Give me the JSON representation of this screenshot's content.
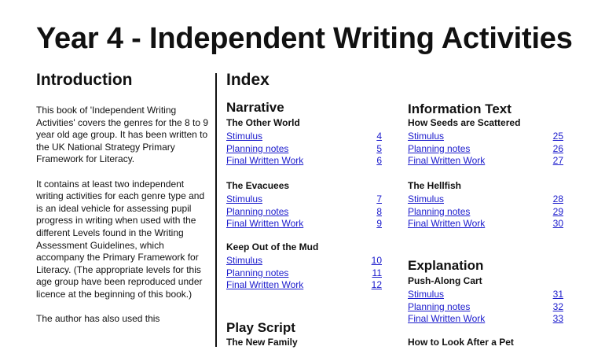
{
  "title": "Year 4 - Independent Writing Activities",
  "intro": {
    "heading": "Introduction",
    "paragraphs": [
      "This book of 'Independent Writing Activities' covers the genres for the 8 to 9 year old age group.  It has been written to the UK National Strategy Primary Framework for Literacy.",
      "It contains at least two independent writing activities for each genre type and is an ideal vehicle for assessing pupil progress in writing when used with the different Levels found in the Writing Assessment Guidelines, which accompany the Primary Framework for Literacy. (The appropriate levels for this age group have been reproduced under licence at the beginning of this book.)",
      "The author has also used this"
    ]
  },
  "index": {
    "heading": "Index",
    "genres": {
      "narrative": "Narrative",
      "play_script": "Play Script",
      "information_text": "Information Text",
      "explanation": "Explanation"
    },
    "blocks": {
      "other_world": {
        "title": "The Other World",
        "entries": [
          {
            "label": "Stimulus",
            "page": "4"
          },
          {
            "label": "Planning notes",
            "page": "5"
          },
          {
            "label": "Final Written Work",
            "page": "6"
          }
        ]
      },
      "evacuees": {
        "title": "The Evacuees",
        "entries": [
          {
            "label": "Stimulus",
            "page": "7"
          },
          {
            "label": "Planning notes",
            "page": "8"
          },
          {
            "label": "Final Written Work",
            "page": "9"
          }
        ]
      },
      "mud": {
        "title": "Keep Out of the Mud",
        "entries": [
          {
            "label": "Stimulus",
            "page": "10"
          },
          {
            "label": "Planning notes",
            "page": "11"
          },
          {
            "label": "Final Written Work",
            "page": "12"
          }
        ]
      },
      "new_family": {
        "title": "The New Family",
        "entries": []
      },
      "seeds": {
        "title": "How Seeds are Scattered",
        "entries": [
          {
            "label": "Stimulus",
            "page": "25"
          },
          {
            "label": "Planning notes",
            "page": "26"
          },
          {
            "label": "Final Written Work",
            "page": "27"
          }
        ]
      },
      "hellfish": {
        "title": "The Hellfish",
        "entries": [
          {
            "label": "Stimulus",
            "page": "28"
          },
          {
            "label": "Planning notes",
            "page": "29"
          },
          {
            "label": "Final Written Work",
            "page": "30"
          }
        ]
      },
      "cart": {
        "title": "Push-Along Cart",
        "entries": [
          {
            "label": "Stimulus",
            "page": "31"
          },
          {
            "label": "Planning notes",
            "page": "32"
          },
          {
            "label": "Final Written Work",
            "page": "33"
          }
        ]
      },
      "pet": {
        "title": "How to Look After a Pet",
        "entries": []
      }
    }
  },
  "colors": {
    "link": "#1a1acc",
    "text": "#111111"
  }
}
